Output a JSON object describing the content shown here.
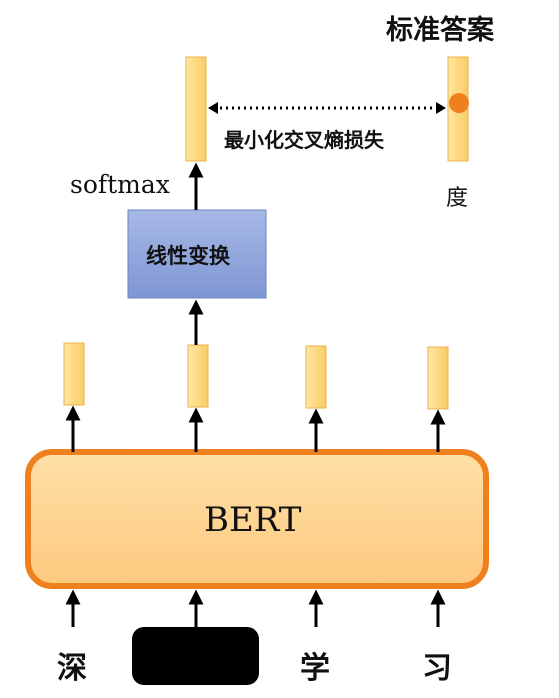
{
  "title": "标准答案",
  "loss_label": "最小化交叉熵损失",
  "softmax_label": "softmax",
  "transform_label": "线性变换",
  "answer_char": "度",
  "model_label": "BERT",
  "input_tokens": [
    "深",
    "",
    "学",
    "习"
  ],
  "masked_token_index": 1,
  "colors": {
    "vector_fill": "#FDD97F",
    "vector_stroke": "#E8B34A",
    "bert_fill": "#FFD89A",
    "bert_stroke": "#F07F1E",
    "transform_fill": "#8FA5DA",
    "transform_stroke": "#6A83C4",
    "answer_dot": "#F07F1E",
    "mask_fill": "#000000",
    "arrow": "#000000"
  }
}
